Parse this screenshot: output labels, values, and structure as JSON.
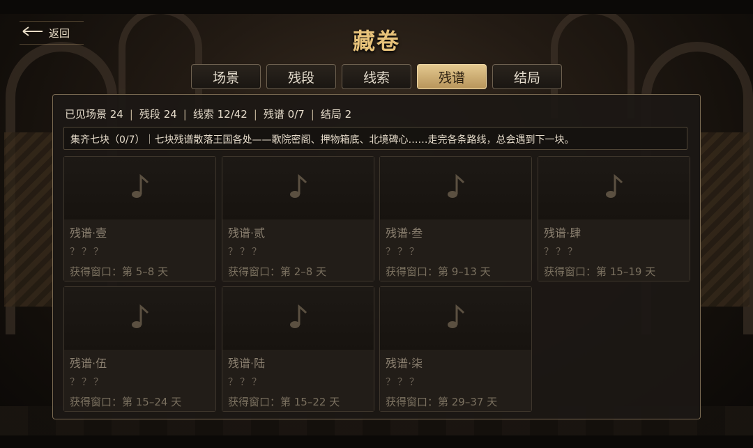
{
  "header": {
    "back_label": "返回",
    "title": "藏卷"
  },
  "tabs": [
    {
      "label": "场景",
      "active": false
    },
    {
      "label": "残段",
      "active": false
    },
    {
      "label": "线索",
      "active": false
    },
    {
      "label": "残谱",
      "active": true
    },
    {
      "label": "结局",
      "active": false
    }
  ],
  "stats": {
    "scenes": "已见场景 24",
    "fragments": "残段 24",
    "clues": "线索 12/42",
    "scores": "残谱 0/7",
    "endings": "结局 2",
    "separator": "|"
  },
  "notice": "集齐七块（0/7）｜七块残谱散落王国各处——歌院密阁、押物箱底、北境碑心……走完各条路线，总会遇到下一块。",
  "cards": [
    {
      "name": "残谱·壹",
      "desc": "？？？",
      "window": "获得窗口：第 5–8 天",
      "icon": "music-note-icon"
    },
    {
      "name": "残谱·贰",
      "desc": "？？？",
      "window": "获得窗口：第 2–8 天",
      "icon": "music-note-icon"
    },
    {
      "name": "残谱·叁",
      "desc": "？？？",
      "window": "获得窗口：第 9–13 天",
      "icon": "music-note-icon"
    },
    {
      "name": "残谱·肆",
      "desc": "？？？",
      "window": "获得窗口：第 15–19 天",
      "icon": "music-note-icon"
    },
    {
      "name": "残谱·伍",
      "desc": "？？？",
      "window": "获得窗口：第 15–24 天",
      "icon": "music-note-icon"
    },
    {
      "name": "残谱·陆",
      "desc": "？？？",
      "window": "获得窗口：第 15–22 天",
      "icon": "music-note-icon"
    },
    {
      "name": "残谱·柒",
      "desc": "？？？",
      "window": "获得窗口：第 29–37 天",
      "icon": "music-note-icon"
    }
  ],
  "colors": {
    "accent_gold": "#e7c27a",
    "active_tab": "#d6b678",
    "panel_bg": "#1c1814",
    "locked_text": "#8b8070"
  }
}
